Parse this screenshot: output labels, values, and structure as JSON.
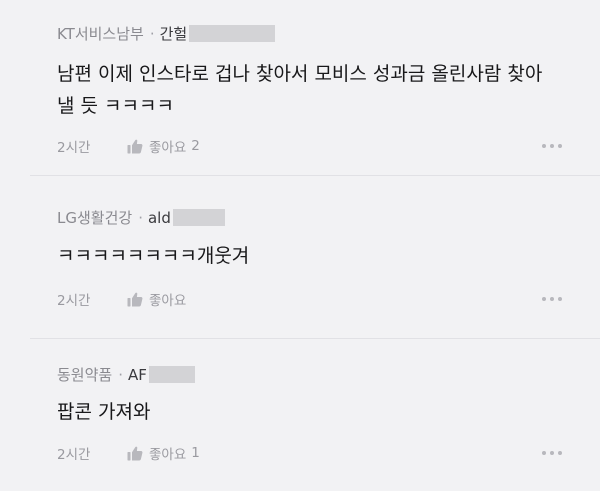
{
  "comments": [
    {
      "company": "KT서비스남부",
      "author": "간헐",
      "body_line1": "남편 이제 인스타로 겁나 찾아서 모비스 성과금 올린사람 찾아",
      "body_line2": "낼 듯 ㅋㅋㅋㅋ",
      "time": "2시간",
      "like_label": "좋아요",
      "like_count": "2"
    },
    {
      "company": "LG생활건강",
      "author": "ald",
      "body_line1": "ㅋㅋㅋㅋㅋㅋㅋㅋ개웃겨",
      "time": "2시간",
      "like_label": "좋아요",
      "like_count": ""
    },
    {
      "company": "동원약품",
      "author": "AF",
      "body_line1": "팝콘 가져와",
      "time": "2시간",
      "like_label": "좋아요",
      "like_count": "1"
    }
  ],
  "separator": "·",
  "icons": {
    "like": "thumbs-up-icon",
    "more": "more-dots-icon"
  },
  "colors": {
    "background": "#f2f2f4",
    "meta": "#8a8a90",
    "mask": "#d3d3d6"
  }
}
